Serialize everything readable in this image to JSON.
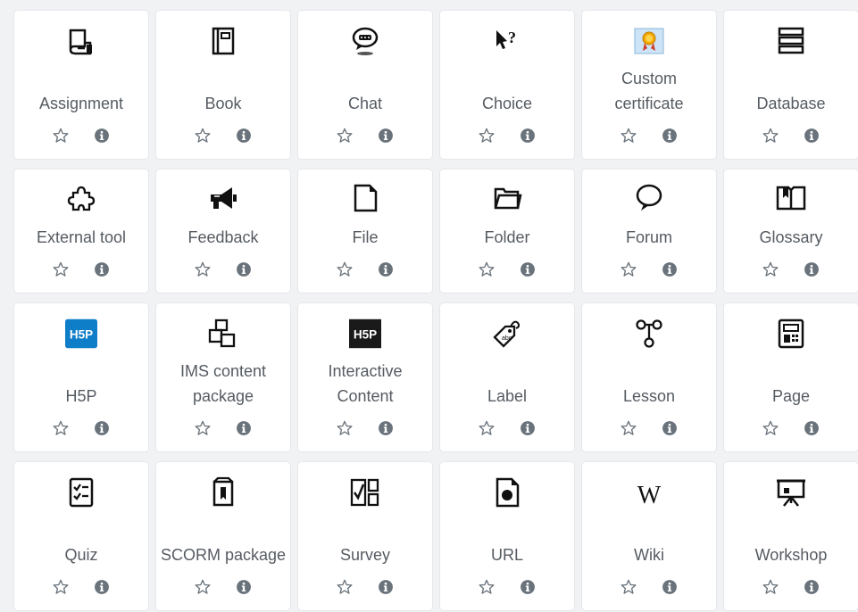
{
  "activities": [
    {
      "id": "assignment",
      "label": "Assignment",
      "icon": "assignment-icon"
    },
    {
      "id": "book",
      "label": "Book",
      "icon": "book-icon"
    },
    {
      "id": "chat",
      "label": "Chat",
      "icon": "chat-icon"
    },
    {
      "id": "choice",
      "label": "Choice",
      "icon": "choice-icon"
    },
    {
      "id": "customcert",
      "label": "Custom certificate",
      "icon": "certificate-icon"
    },
    {
      "id": "database",
      "label": "Database",
      "icon": "database-icon"
    },
    {
      "id": "lti",
      "label": "External tool",
      "icon": "puzzle-icon"
    },
    {
      "id": "feedback",
      "label": "Feedback",
      "icon": "megaphone-icon"
    },
    {
      "id": "file",
      "label": "File",
      "icon": "file-icon"
    },
    {
      "id": "folder",
      "label": "Folder",
      "icon": "folder-icon"
    },
    {
      "id": "forum",
      "label": "Forum",
      "icon": "forum-icon"
    },
    {
      "id": "glossary",
      "label": "Glossary",
      "icon": "glossary-icon"
    },
    {
      "id": "h5p",
      "label": "H5P",
      "icon": "h5p-icon"
    },
    {
      "id": "imscp",
      "label": "IMS content package",
      "icon": "ims-package-icon"
    },
    {
      "id": "hvp",
      "label": "Interactive Content",
      "icon": "interactive-content-icon"
    },
    {
      "id": "label",
      "label": "Label",
      "icon": "label-icon"
    },
    {
      "id": "lesson",
      "label": "Lesson",
      "icon": "lesson-icon"
    },
    {
      "id": "page",
      "label": "Page",
      "icon": "page-icon"
    },
    {
      "id": "quiz",
      "label": "Quiz",
      "icon": "quiz-icon"
    },
    {
      "id": "scorm",
      "label": "SCORM package",
      "icon": "scorm-icon"
    },
    {
      "id": "survey",
      "label": "Survey",
      "icon": "survey-icon"
    },
    {
      "id": "url",
      "label": "URL",
      "icon": "url-icon"
    },
    {
      "id": "wiki",
      "label": "Wiki",
      "icon": "wiki-icon"
    },
    {
      "id": "workshop",
      "label": "Workshop",
      "icon": "workshop-icon"
    }
  ],
  "icons": {
    "star": "star-outline-icon",
    "info": "info-circle-icon",
    "h5p_text": "H5P"
  },
  "colors": {
    "h5p_blue": "#0e7ec8",
    "hvp_black": "#1a1a1a",
    "label_text": "#555b62",
    "icon_color": "#111111",
    "action_color": "#6a737b"
  }
}
